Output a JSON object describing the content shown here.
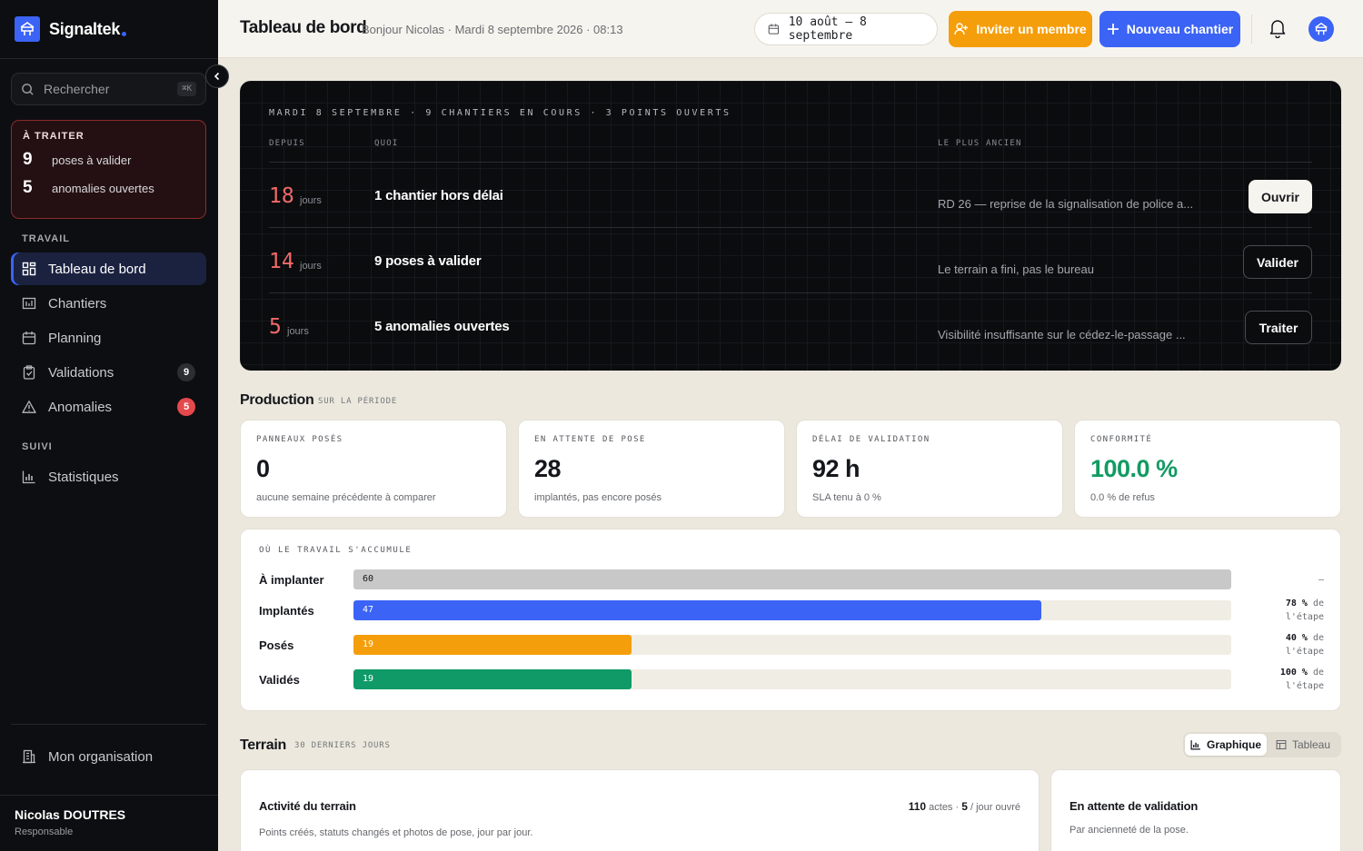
{
  "brand": {
    "name": "Signaltek",
    "accent": "#3b63f5"
  },
  "search": {
    "placeholder": "Rechercher",
    "shortcut": "⌘K"
  },
  "todo": {
    "title": "À TRAITER",
    "items": [
      {
        "count": "9",
        "label": "poses à valider"
      },
      {
        "count": "5",
        "label": "anomalies ouvertes"
      }
    ]
  },
  "nav": {
    "section_work": "TRAVAIL",
    "section_follow": "SUIVI",
    "items": [
      {
        "label": "Tableau de bord",
        "icon": "dashboard-icon"
      },
      {
        "label": "Chantiers",
        "icon": "map-icon"
      },
      {
        "label": "Planning",
        "icon": "calendar-icon"
      },
      {
        "label": "Validations",
        "icon": "clipboard-check-icon",
        "badge": "9"
      },
      {
        "label": "Anomalies",
        "icon": "warning-icon",
        "badge": "5"
      },
      {
        "label": "Statistiques",
        "icon": "bar-chart-icon"
      }
    ],
    "org": "Mon organisation"
  },
  "user": {
    "name": "Nicolas DOUTRES",
    "role": "Responsable"
  },
  "header": {
    "title": "Tableau de bord",
    "subtitle": "Bonjour Nicolas · Mardi 8 septembre 2026 · 08:13",
    "date_range": "10 août – 8 septembre",
    "invite_label": "Inviter un membre",
    "new_label": "Nouveau chantier"
  },
  "hero": {
    "heading": "MARDI 8 SEPTEMBRE · 9 CHANTIERS EN COURS · 3 POINTS OUVERTS",
    "columns": {
      "since": "DEPUIS",
      "what": "QUOI",
      "oldest": "LE PLUS ANCIEN"
    },
    "rows": [
      {
        "num": "18",
        "unit": "jours",
        "what": "1 chantier hors délai",
        "oldest": "RD 26 — reprise de la signalisation de police a...",
        "action": "Ouvrir"
      },
      {
        "num": "14",
        "unit": "jours",
        "what": "9 poses à valider",
        "oldest": "Le terrain a fini, pas le bureau",
        "action": "Valider"
      },
      {
        "num": "5",
        "unit": "jours",
        "what": "5 anomalies ouvertes",
        "oldest": "Visibilité insuffisante sur le cédez-le-passage ...",
        "action": "Traiter"
      }
    ]
  },
  "production": {
    "title": "Production",
    "tag": "SUR LA PÉRIODE",
    "kpis": [
      {
        "label": "PANNEAUX POSÉS",
        "value": "0",
        "sub": "aucune semaine précédente à comparer"
      },
      {
        "label": "EN ATTENTE DE POSE",
        "value": "28",
        "sub": "implantés, pas encore posés"
      },
      {
        "label": "DÉLAI DE VALIDATION",
        "value": "92 h",
        "sub": "SLA tenu à 0 %"
      },
      {
        "label": "CONFORMITÉ",
        "value": "100.0 %",
        "sub": "0.0 % de refus"
      }
    ]
  },
  "accumulation": {
    "title": "OÙ LE TRAVAIL S'ACCUMULE",
    "max": 60,
    "rows": [
      {
        "label": "À implanter",
        "value": 60,
        "value_text": "60",
        "color": "#c8c8c8",
        "pct": "",
        "pct_suffix": "",
        "dash": "–"
      },
      {
        "label": "Implantés",
        "value": 47,
        "value_text": "47",
        "color": "#3b63f5",
        "pct": "78 %",
        "pct_suffix": "de l'étape"
      },
      {
        "label": "Posés",
        "value": 19,
        "value_text": "19",
        "color": "#f59e0b",
        "pct": "40 %",
        "pct_suffix": "de l'étape"
      },
      {
        "label": "Validés",
        "value": 19,
        "value_text": "19",
        "color": "#0f9a68",
        "pct": "100 %",
        "pct_suffix": "de l'étape"
      }
    ]
  },
  "terrain": {
    "title": "Terrain",
    "tag": "30 DERNIERS JOURS",
    "toggle": {
      "chart": "Graphique",
      "table": "Tableau"
    },
    "activity": {
      "title": "Activité du terrain",
      "sub": "Points créés, statuts changés et photos de pose, jour par jour.",
      "acts": "110",
      "acts_label": "actes ·",
      "per_day": "5",
      "per_day_label": "/ jour ouvré"
    },
    "pending": {
      "title": "En attente de validation",
      "sub": "Par ancienneté de la pose."
    }
  }
}
